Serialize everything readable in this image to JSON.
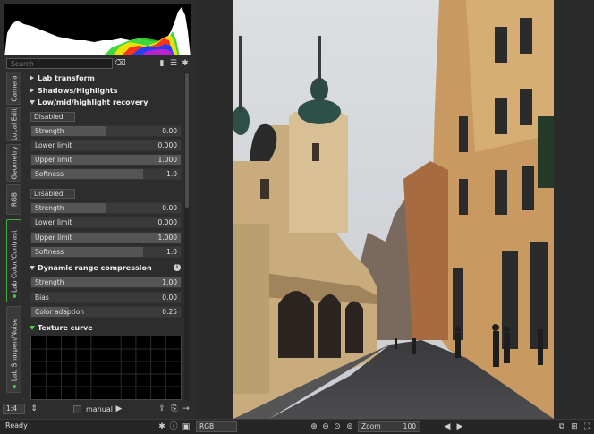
{
  "search": {
    "placeholder": "Search"
  },
  "vertical_tabs": [
    {
      "label": "Camera"
    },
    {
      "label": "Local Edit"
    },
    {
      "label": "Geometry"
    },
    {
      "label": "RGB"
    },
    {
      "label": "Lab Color/Contrast"
    },
    {
      "label": "Lab Sharpen/Noise"
    }
  ],
  "tools": {
    "lab_transform": "Lab transform",
    "shadows_highlights": "Shadows/Highlights",
    "low_mid_highlight": "Low/mid/highlight recovery",
    "block1": {
      "mode": "Disabled",
      "sliders": [
        {
          "label": "Strength",
          "value": "0.00",
          "fill": 0.5
        },
        {
          "label": "Lower limit",
          "value": "0.000",
          "fill": 0.0
        },
        {
          "label": "Upper limit",
          "value": "1.000",
          "fill": 1.0
        },
        {
          "label": "Softness",
          "value": "1.0",
          "fill": 0.75
        }
      ]
    },
    "block2": {
      "mode": "Disabled",
      "sliders": [
        {
          "label": "Strength",
          "value": "0.00",
          "fill": 0.5
        },
        {
          "label": "Lower limit",
          "value": "0.000",
          "fill": 0.0
        },
        {
          "label": "Upper limit",
          "value": "1.000",
          "fill": 1.0
        },
        {
          "label": "Softness",
          "value": "1.0",
          "fill": 0.75
        }
      ]
    },
    "dynamic_range": {
      "title": "Dynamic range compression",
      "sliders": [
        {
          "label": "Strength",
          "value": "1.00",
          "fill": 1.0
        },
        {
          "label": "Bias",
          "value": "0.00",
          "fill": 0.0
        },
        {
          "label": "Color adaption",
          "value": "0.25",
          "fill": 0.25
        }
      ]
    },
    "texture_curve": "Texture curve"
  },
  "bottom": {
    "zoom_ratio": "1:4",
    "manual_label": "manual"
  },
  "status": {
    "text": "Ready"
  },
  "viewer": {
    "channel": "RGB",
    "zoom_label": "Zoom",
    "zoom_value": "100"
  }
}
